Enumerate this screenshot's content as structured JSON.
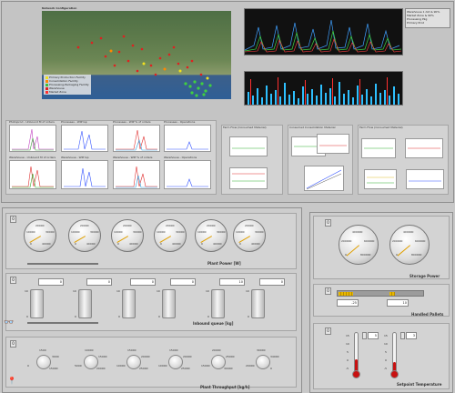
{
  "top": {
    "map_title": "Network Configuration",
    "map_legend": [
      "Primary Production Facility",
      "Consolidation Facility",
      "Processing-Packaging Facility",
      "Warehouse",
      "Market Zone"
    ],
    "legend_colors": [
      "#f0e020",
      "#ff8800",
      "#40c040",
      "#e02020",
      "#ff3030"
    ],
    "chart_legend": [
      "Warehouse 1 dot & 90%",
      "Market Zone & 90%",
      "Processing Pkg",
      "Primary Prod"
    ],
    "small_chart_titles": [
      "Photoprod - Unbound M of orders",
      "Processes - WIP Gp",
      "Processes - WIP % of orders",
      "Processes - Operations",
      "Warehouse - Unbound M of orders",
      "Warehouse - WIP Gp",
      "Warehouse - WIP % of orders",
      "Warehouse - Operations"
    ],
    "group2_title": "Farm Flow (Consumed Material)",
    "group3_title": "Consumed Consolidation Material",
    "group4_title": "Farm Flow (Consumed Material)"
  },
  "plant_power": {
    "label": "Plant Power [W]",
    "ctl": "0",
    "gauges": [
      {
        "ticks": [
          "20000",
          "10000",
          "30000",
          "0",
          "40000"
        ]
      },
      {
        "ticks": [
          "20000",
          "10000",
          "30000",
          "0",
          "40000"
        ]
      },
      {
        "ticks": [
          "20000",
          "10000",
          "30000",
          "0",
          "40000"
        ]
      },
      {
        "ticks": [
          "20000",
          "10000",
          "30000",
          "0",
          "40000"
        ]
      },
      {
        "ticks": [
          "20000",
          "10000",
          "30000",
          "0",
          "40000"
        ]
      },
      {
        "ticks": [
          "20000",
          "10000",
          "30000",
          "0",
          "40000"
        ]
      }
    ]
  },
  "storage_power": {
    "label": "Storage Power",
    "ctl": "0",
    "gauges": [
      {
        "ticks": [
          "400000",
          "200000",
          "600000",
          "0",
          "800000"
        ]
      },
      {
        "ticks": [
          "400000",
          "200000",
          "600000",
          "0",
          "800000"
        ]
      }
    ]
  },
  "inbound_queue": {
    "label": "Inbound queue [kg]",
    "ctl": "0",
    "tanks": [
      {
        "value": "0",
        "top": "10",
        "bottom": "0"
      },
      {
        "value": "0",
        "top": "10",
        "bottom": "0"
      },
      {
        "value": "0",
        "top": "10",
        "bottom": "0"
      },
      {
        "value": "0",
        "top": "10",
        "bottom": "0"
      },
      {
        "value": "10",
        "top": "10",
        "bottom": "0"
      },
      {
        "value": "0",
        "top": "10",
        "bottom": "0"
      }
    ]
  },
  "handled_pallets": {
    "label": "Handled Pallets",
    "ctl": "0",
    "value1": "-25",
    "value2": "10"
  },
  "plant_throughput": {
    "label": "Plant Throughput [kg/h]",
    "ctl": "0",
    "knobs": [
      {
        "ticks": [
          "1500",
          "0",
          "3000",
          "15000"
        ]
      },
      {
        "ticks": [
          "10000",
          "5000",
          "15000",
          "20000"
        ]
      },
      {
        "ticks": [
          "15000",
          "10000",
          "20000",
          "25000"
        ]
      },
      {
        "ticks": [
          "15000",
          "10000",
          "20000",
          "25000"
        ]
      },
      {
        "ticks": [
          "20000",
          "15000",
          "25000",
          "30000"
        ]
      },
      {
        "ticks": [
          "30000",
          "20000",
          "34000",
          "0"
        ]
      }
    ]
  },
  "setpoint": {
    "label": "Setpoint Temperature",
    "ctl": "0",
    "thermos": [
      {
        "ticks": [
          "15",
          "10",
          "5",
          "0",
          "-5"
        ],
        "value": "5",
        "fill": 0.35
      },
      {
        "ticks": [
          "15",
          "10",
          "5",
          "0",
          "-5"
        ],
        "value": "3",
        "fill": 0.28
      }
    ]
  }
}
